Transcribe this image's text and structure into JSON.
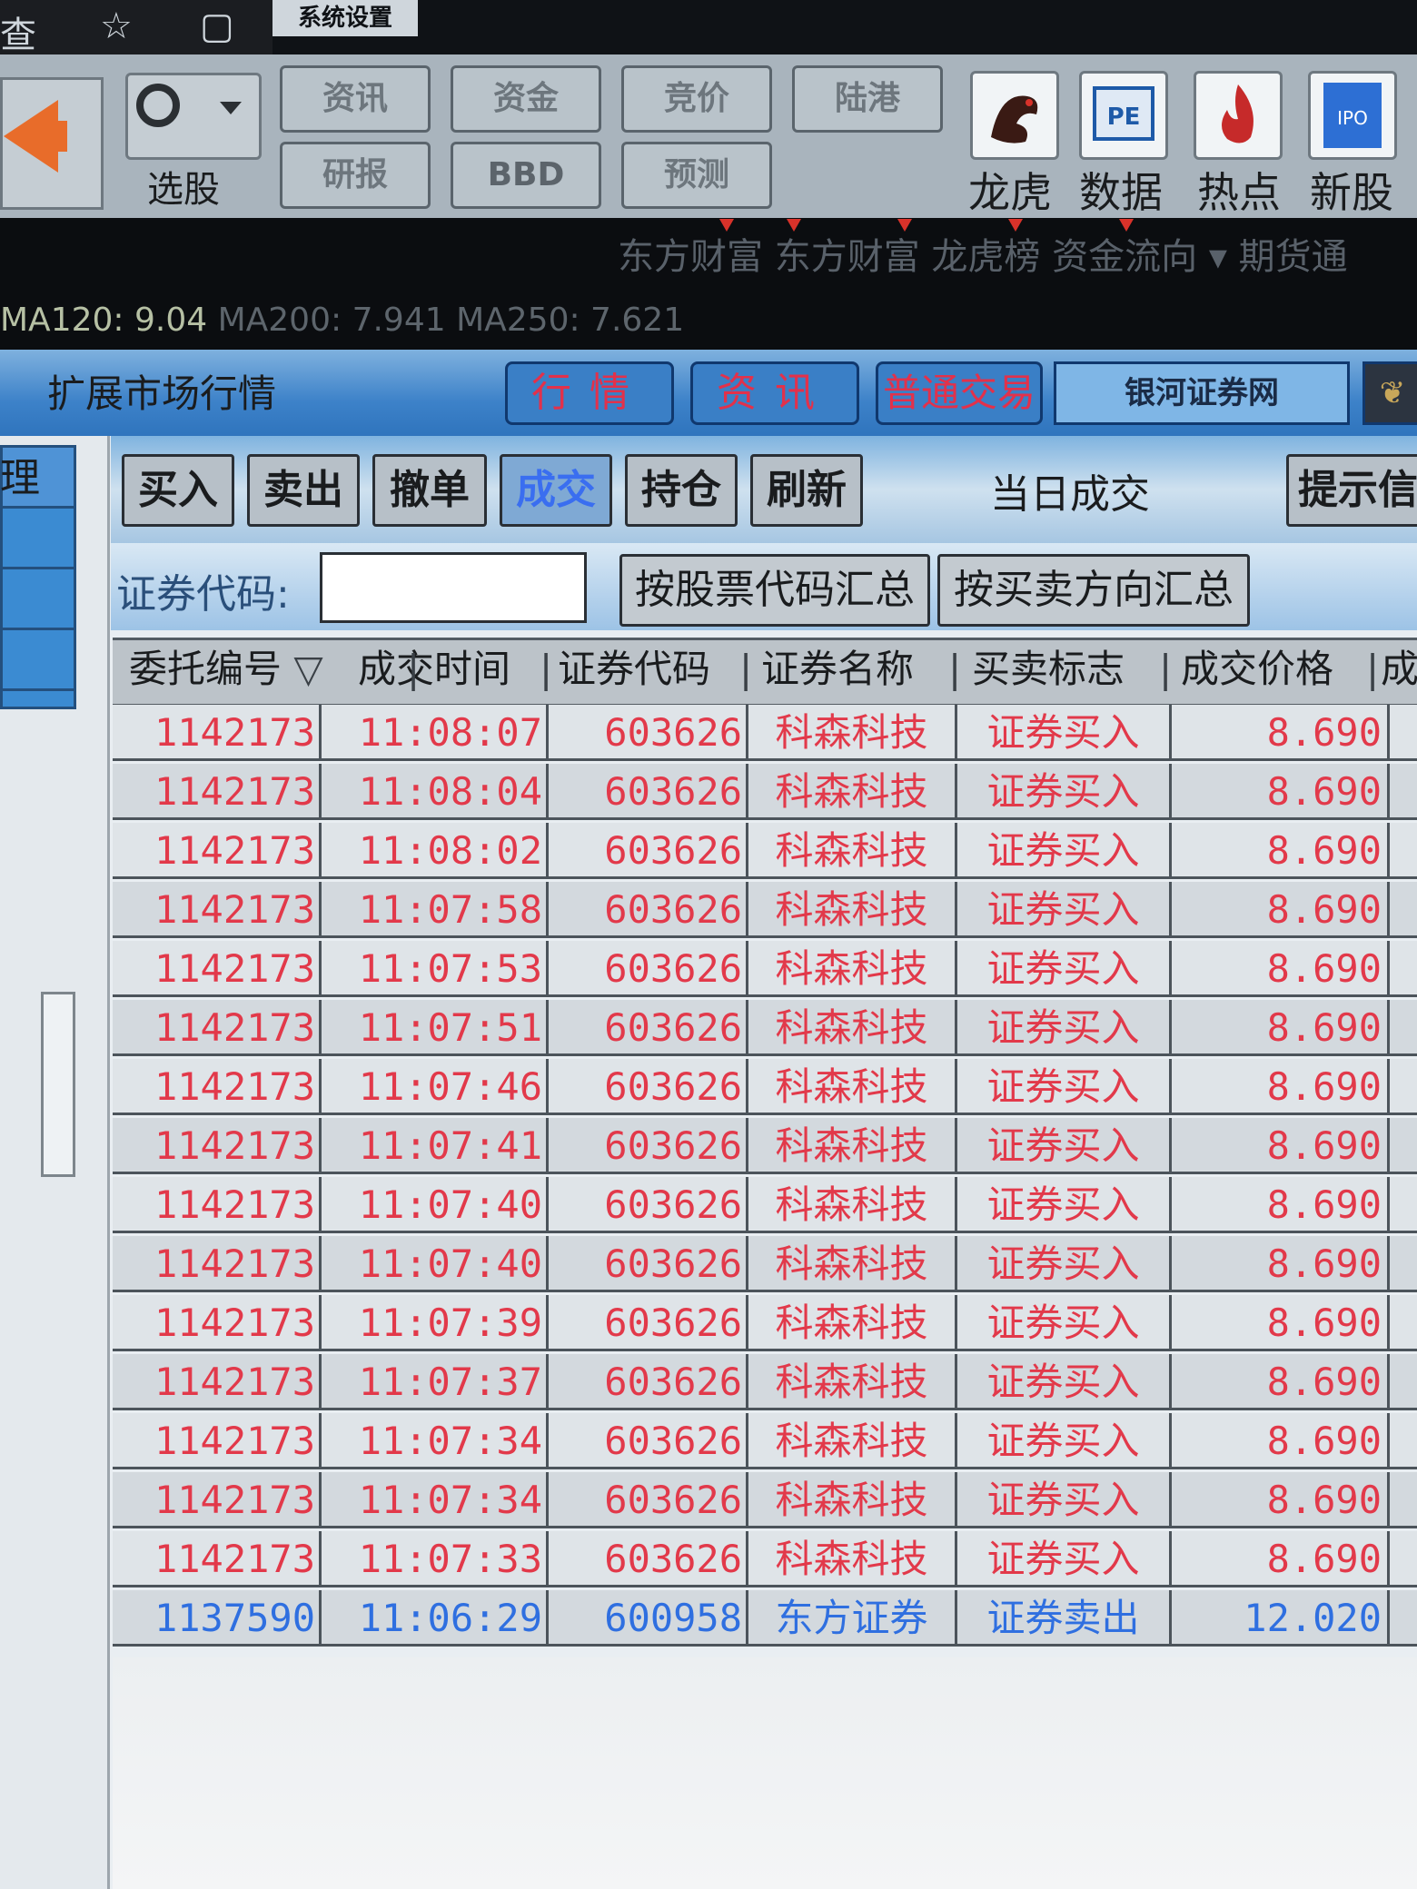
{
  "window": {
    "left_label_1": "查",
    "left_label_2": "☆",
    "left_label_3": "▢",
    "app_title": "系统设置"
  },
  "toolbar": {
    "select_stock_label": "选股",
    "buttons_row1": [
      "资讯",
      "资金",
      "竞价",
      "陆港"
    ],
    "buttons_row2": [
      "研报",
      "BBD",
      "预测"
    ],
    "icons": [
      {
        "label": "龙虎",
        "icon": "dragon-icon"
      },
      {
        "label": "数据",
        "icon": "pe-icon",
        "text": "PE"
      },
      {
        "label": "热点",
        "icon": "fire-icon"
      },
      {
        "label": "新股",
        "icon": "ipo-icon",
        "text": "IPO"
      }
    ]
  },
  "info_strip": {
    "text": "东方财富  东方财富  龙虎榜  资金流向  ▾  期货通",
    "ma_text": "MA120: 9.04",
    "ma_dim": "MA200: 7.941  MA250: 7.621"
  },
  "header": {
    "title": "扩展市场行情",
    "tabs": [
      "行情",
      "资讯",
      "普通交易"
    ],
    "bank_tab": "银河证券网",
    "corner_icon": "❦"
  },
  "sidebar": {
    "label": "理"
  },
  "actions": {
    "buttons": [
      "买入",
      "卖出",
      "撤单",
      "成交",
      "持仓",
      "刷新"
    ],
    "today_label": "当日成交",
    "tips_button": "提示信息"
  },
  "filter": {
    "code_label": "证券代码:",
    "code_value": "",
    "by_code_button": "按股票代码汇总",
    "by_direction_button": "按买卖方向汇总"
  },
  "table": {
    "columns": [
      "委托编号",
      "成交时间",
      "证券代码",
      "证券名称",
      "买卖标志",
      "成交价格",
      "成"
    ],
    "sort_marker": "▽",
    "rows": [
      {
        "id": "1142173",
        "time": "11:08:07",
        "code": "603626",
        "name": "科森科技",
        "side": "证券买入",
        "price": "8.690",
        "type": "buy"
      },
      {
        "id": "1142173",
        "time": "11:08:04",
        "code": "603626",
        "name": "科森科技",
        "side": "证券买入",
        "price": "8.690",
        "type": "buy"
      },
      {
        "id": "1142173",
        "time": "11:08:02",
        "code": "603626",
        "name": "科森科技",
        "side": "证券买入",
        "price": "8.690",
        "type": "buy"
      },
      {
        "id": "1142173",
        "time": "11:07:58",
        "code": "603626",
        "name": "科森科技",
        "side": "证券买入",
        "price": "8.690",
        "type": "buy"
      },
      {
        "id": "1142173",
        "time": "11:07:53",
        "code": "603626",
        "name": "科森科技",
        "side": "证券买入",
        "price": "8.690",
        "type": "buy"
      },
      {
        "id": "1142173",
        "time": "11:07:51",
        "code": "603626",
        "name": "科森科技",
        "side": "证券买入",
        "price": "8.690",
        "type": "buy"
      },
      {
        "id": "1142173",
        "time": "11:07:46",
        "code": "603626",
        "name": "科森科技",
        "side": "证券买入",
        "price": "8.690",
        "type": "buy"
      },
      {
        "id": "1142173",
        "time": "11:07:41",
        "code": "603626",
        "name": "科森科技",
        "side": "证券买入",
        "price": "8.690",
        "type": "buy"
      },
      {
        "id": "1142173",
        "time": "11:07:40",
        "code": "603626",
        "name": "科森科技",
        "side": "证券买入",
        "price": "8.690",
        "type": "buy"
      },
      {
        "id": "1142173",
        "time": "11:07:40",
        "code": "603626",
        "name": "科森科技",
        "side": "证券买入",
        "price": "8.690",
        "type": "buy"
      },
      {
        "id": "1142173",
        "time": "11:07:39",
        "code": "603626",
        "name": "科森科技",
        "side": "证券买入",
        "price": "8.690",
        "type": "buy"
      },
      {
        "id": "1142173",
        "time": "11:07:37",
        "code": "603626",
        "name": "科森科技",
        "side": "证券买入",
        "price": "8.690",
        "type": "buy"
      },
      {
        "id": "1142173",
        "time": "11:07:34",
        "code": "603626",
        "name": "科森科技",
        "side": "证券买入",
        "price": "8.690",
        "type": "buy"
      },
      {
        "id": "1142173",
        "time": "11:07:34",
        "code": "603626",
        "name": "科森科技",
        "side": "证券买入",
        "price": "8.690",
        "type": "buy"
      },
      {
        "id": "1142173",
        "time": "11:07:33",
        "code": "603626",
        "name": "科森科技",
        "side": "证券买入",
        "price": "8.690",
        "type": "buy"
      },
      {
        "id": "1137590",
        "time": "11:06:29",
        "code": "600958",
        "name": "东方证券",
        "side": "证券卖出",
        "price": "12.020",
        "type": "sell"
      }
    ]
  },
  "colors": {
    "buy": "#e2394a",
    "sell": "#2f6fe0",
    "header_blue": "#3d82c9"
  }
}
